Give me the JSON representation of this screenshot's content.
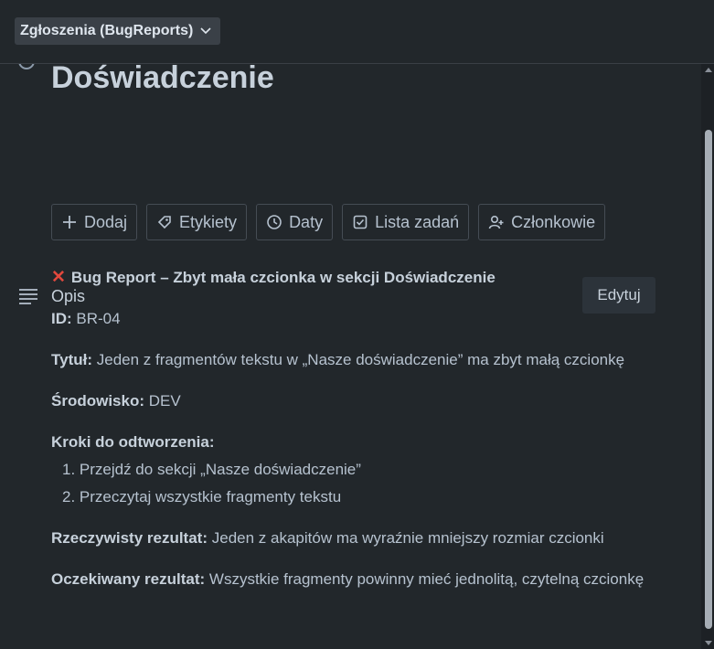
{
  "topbar": {
    "list_name": "Zgłoszenia (BugReports)"
  },
  "card": {
    "title": "Zbyt mała czcionka w sekcji Doświadczenie",
    "actions": [
      {
        "label": "Dodaj",
        "icon": "plus-icon"
      },
      {
        "label": "Etykiety",
        "icon": "tag-icon"
      },
      {
        "label": "Daty",
        "icon": "clock-icon"
      },
      {
        "label": "Lista zadań",
        "icon": "checklist-icon"
      },
      {
        "label": "Członkowie",
        "icon": "add-member-icon"
      }
    ]
  },
  "description": {
    "label": "Opis",
    "edit_label": "Edytuj",
    "heading": "Bug Report – Zbyt mała czcionka w sekcji Doświadczenie",
    "heading_icon": "red-x-icon",
    "id_label": "ID:",
    "id_value": "BR-04",
    "title_label": "Tytuł:",
    "title_value": "Jeden z fragmentów tekstu w „Nasze doświadczenie” ma zbyt małą czcionkę",
    "env_label": "Środowisko:",
    "env_value": "DEV",
    "steps_label": "Kroki do odtworzenia:",
    "steps": [
      "1. Przejdź do sekcji „Nasze doświadczenie”",
      "2. Przeczytaj wszystkie fragmenty tekstu"
    ],
    "actual_label": "Rzeczywisty rezultat:",
    "actual_value": "Jeden z akapitów ma wyraźnie mniejszy rozmiar czcionki",
    "expected_label": "Oczekiwany rezultat:",
    "expected_value": "Wszystkie fragmenty powinny mieć jednolitą, czytelną czcionkę"
  },
  "colors": {
    "background": "#22272b",
    "button_bg": "#2c333a",
    "accent_red": "#e2483d",
    "text": "#b6c2cf"
  }
}
